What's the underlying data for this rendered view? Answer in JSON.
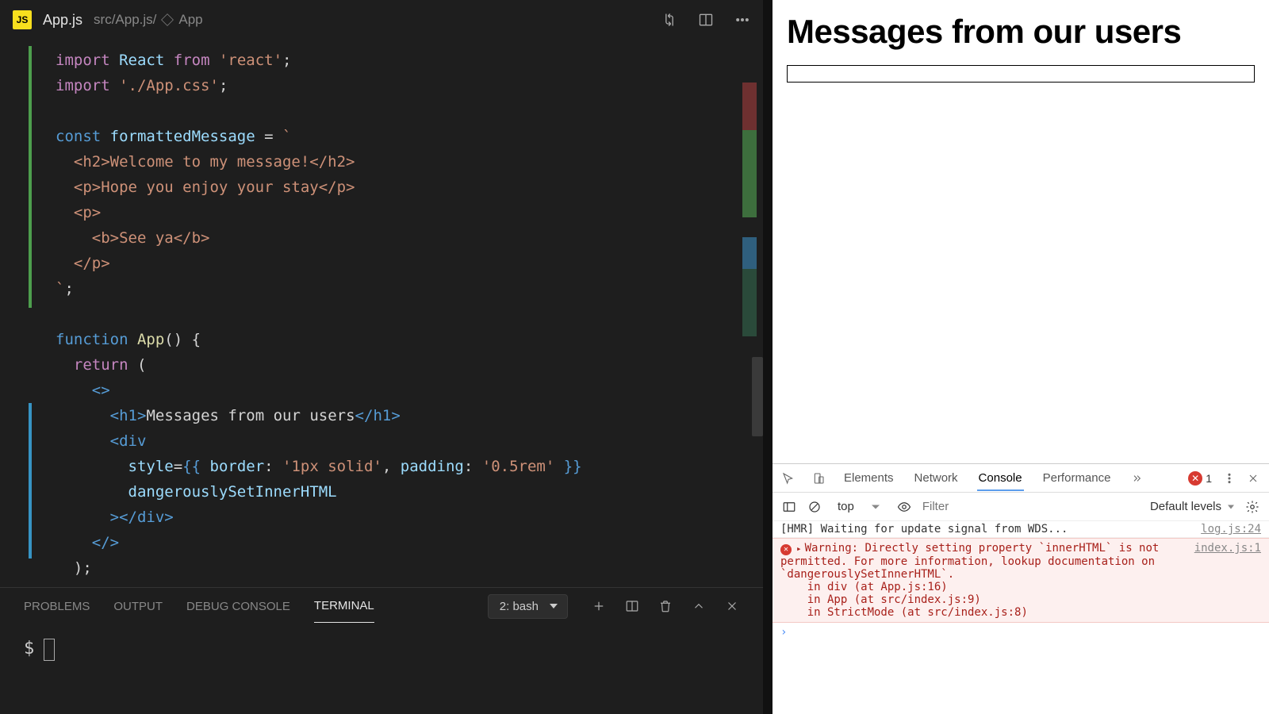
{
  "editor": {
    "file_icon_text": "JS",
    "filename": "App.js",
    "breadcrumb_path": "src/App.js/",
    "breadcrumb_symbol": "App",
    "code_lines": [
      [
        [
          "k-import",
          "import"
        ],
        [
          "txt",
          " "
        ],
        [
          "ident",
          "React"
        ],
        [
          "txt",
          " "
        ],
        [
          "k-import",
          "from"
        ],
        [
          "txt",
          " "
        ],
        [
          "str",
          "'react'"
        ],
        [
          "txt",
          ";"
        ]
      ],
      [
        [
          "k-import",
          "import"
        ],
        [
          "txt",
          " "
        ],
        [
          "str",
          "'./App.css'"
        ],
        [
          "txt",
          ";"
        ]
      ],
      [
        [
          "txt",
          ""
        ]
      ],
      [
        [
          "k-const",
          "const"
        ],
        [
          "txt",
          " "
        ],
        [
          "ident",
          "formattedMessage"
        ],
        [
          "txt",
          " = "
        ],
        [
          "str",
          "`"
        ]
      ],
      [
        [
          "str",
          "  <h2>Welcome to my message!</h2>"
        ]
      ],
      [
        [
          "str",
          "  <p>Hope you enjoy your stay</p>"
        ]
      ],
      [
        [
          "str",
          "  <p>"
        ]
      ],
      [
        [
          "str",
          "    <b>See ya</b>"
        ]
      ],
      [
        [
          "str",
          "  </p>"
        ]
      ],
      [
        [
          "str",
          "`"
        ],
        [
          "txt",
          ";"
        ]
      ],
      [
        [
          "txt",
          ""
        ]
      ],
      [
        [
          "k-func",
          "function"
        ],
        [
          "txt",
          " "
        ],
        [
          "fn",
          "App"
        ],
        [
          "txt",
          "() {"
        ]
      ],
      [
        [
          "txt",
          "  "
        ],
        [
          "k-return",
          "return"
        ],
        [
          "txt",
          " ("
        ]
      ],
      [
        [
          "txt",
          "    "
        ],
        [
          "tag",
          "<>"
        ]
      ],
      [
        [
          "txt",
          "      "
        ],
        [
          "tag",
          "<"
        ],
        [
          "tagname",
          "h1"
        ],
        [
          "tag",
          ">"
        ],
        [
          "txt",
          "Messages from our users"
        ],
        [
          "tag",
          "</"
        ],
        [
          "tagname",
          "h1"
        ],
        [
          "tag",
          ">"
        ]
      ],
      [
        [
          "txt",
          "      "
        ],
        [
          "tag",
          "<"
        ],
        [
          "tagname",
          "div"
        ]
      ],
      [
        [
          "txt",
          "        "
        ],
        [
          "attrn",
          "style"
        ],
        [
          "txt",
          "="
        ],
        [
          "jb",
          "{{"
        ],
        [
          "txt",
          " "
        ],
        [
          "ident",
          "border"
        ],
        [
          "txt",
          ": "
        ],
        [
          "str",
          "'1px solid'"
        ],
        [
          "txt",
          ", "
        ],
        [
          "ident",
          "padding"
        ],
        [
          "txt",
          ": "
        ],
        [
          "str",
          "'0.5rem'"
        ],
        [
          "txt",
          " "
        ],
        [
          "jb",
          "}}"
        ]
      ],
      [
        [
          "txt",
          "        "
        ],
        [
          "attrn",
          "dangerouslySetInnerHTML"
        ]
      ],
      [
        [
          "txt",
          "      "
        ],
        [
          "tag",
          "></"
        ],
        [
          "tagname",
          "div"
        ],
        [
          "tag",
          ">"
        ]
      ],
      [
        [
          "txt",
          "    "
        ],
        [
          "tag",
          "</>"
        ]
      ],
      [
        [
          "txt",
          "  );"
        ]
      ],
      [
        [
          "txt",
          "}"
        ]
      ]
    ]
  },
  "panel": {
    "tabs": [
      "PROBLEMS",
      "OUTPUT",
      "DEBUG CONSOLE",
      "TERMINAL"
    ],
    "active_tab": "TERMINAL",
    "shell_label": "2: bash",
    "prompt": "$"
  },
  "preview": {
    "heading": "Messages from our users"
  },
  "devtools": {
    "tabs": [
      "Elements",
      "Network",
      "Console",
      "Performance"
    ],
    "active_tab": "Console",
    "error_count": "1",
    "context_label": "top",
    "filter_placeholder": "Filter",
    "levels_label": "Default levels",
    "log_hmr": "[HMR] Waiting for update signal from WDS...",
    "log_hmr_src": "log.js:24",
    "error_src": "index.js:1",
    "error_lines": [
      "Warning: Directly setting property `innerHTML` is not permitted. For more information, lookup documentation on `dangerouslySetInnerHTML`.",
      "    in div (at App.js:16)",
      "    in App (at src/index.js:9)",
      "    in StrictMode (at src/index.js:8)"
    ]
  }
}
